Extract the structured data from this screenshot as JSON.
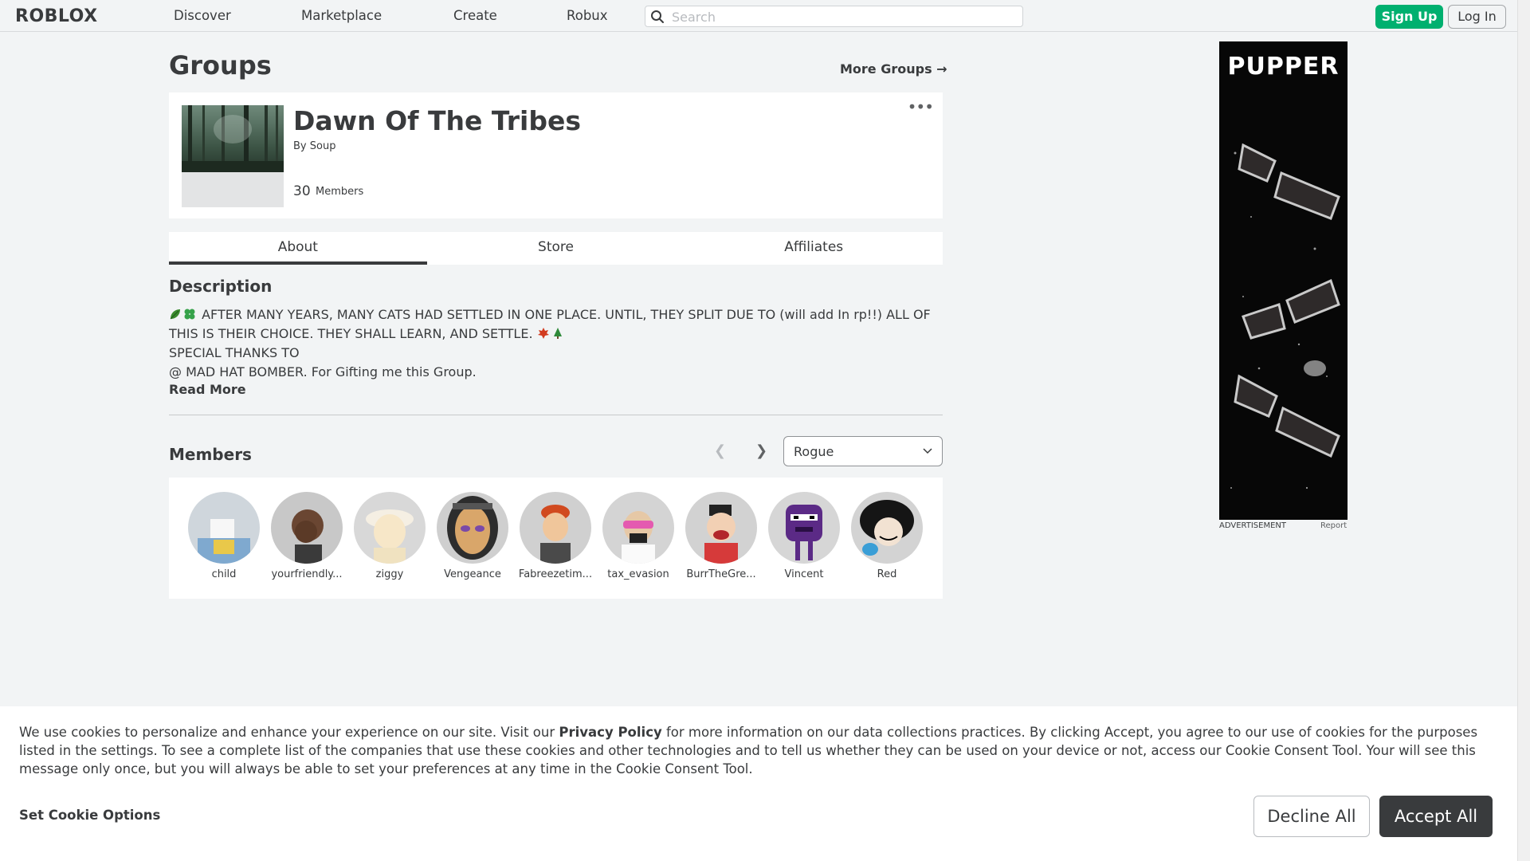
{
  "header": {
    "logo": "ROBLOX",
    "nav": [
      "Discover",
      "Marketplace",
      "Create",
      "Robux"
    ],
    "search_placeholder": "Search",
    "signup_label": "Sign Up",
    "login_label": "Log In"
  },
  "page": {
    "title": "Groups",
    "more_groups": "More Groups →"
  },
  "group": {
    "name": "Dawn Of The Tribes",
    "by_label": "By",
    "owner": "Soup",
    "member_count": "30",
    "member_count_label": "Members",
    "more_menu": "•••"
  },
  "tabs": [
    "About",
    "Store",
    "Affiliates"
  ],
  "description": {
    "heading": "Description",
    "line1": "AFTER MANY YEARS, MANY CATS HAD SETTLED IN ONE PLACE. UNTIL, THEY SPLIT DUE TO (will add In rp!!) ALL OF THIS IS THEIR CHOICE. THEY SHALL LEARN, AND SETTLE.",
    "line2": "SPECIAL THANKS TO",
    "line3": "@ MAD HAT BOMBER. For Gifting me this Group.",
    "read_more": "Read More"
  },
  "members": {
    "heading": "Members",
    "role_selected": "Rogue",
    "list": [
      {
        "name": "child",
        "color": "#cfd6dc"
      },
      {
        "name": "yourfriendly...",
        "color": "#c8c8c8"
      },
      {
        "name": "ziggy",
        "color": "#d8d8d8"
      },
      {
        "name": "Vengeance",
        "color": "#cfcfcf"
      },
      {
        "name": "Fabreezetim...",
        "color": "#d0d0d0"
      },
      {
        "name": "tax_evasion",
        "color": "#d4d4d4"
      },
      {
        "name": "BurrTheGre...",
        "color": "#d2d2d2"
      },
      {
        "name": "Vincent",
        "color": "#d6d6d6"
      },
      {
        "name": "Red",
        "color": "#d3d3d3"
      }
    ]
  },
  "ad": {
    "title": "PUPPER",
    "label": "ADVERTISEMENT",
    "report": "Report"
  },
  "cookie": {
    "text_before": "We use cookies to personalize and enhance your experience on our site. Visit our",
    "link": "Privacy Policy",
    "text_after": "for more information on our data collections practices. By clicking Accept, you agree to our use of cookies for the purposes listed in the settings. To see a complete list of the companies that use these cookies and other technologies and to tell us whether they can be used on your device or not, access our Cookie Consent Tool. Your will see this message only once, but you will always be able to set your preferences at any time in the Cookie Consent Tool.",
    "options": "Set Cookie Options",
    "decline": "Decline All",
    "accept": "Accept All"
  },
  "colors": {
    "brand_green": "#00b06f",
    "text": "#393b3d",
    "background": "#f2f4f5"
  }
}
